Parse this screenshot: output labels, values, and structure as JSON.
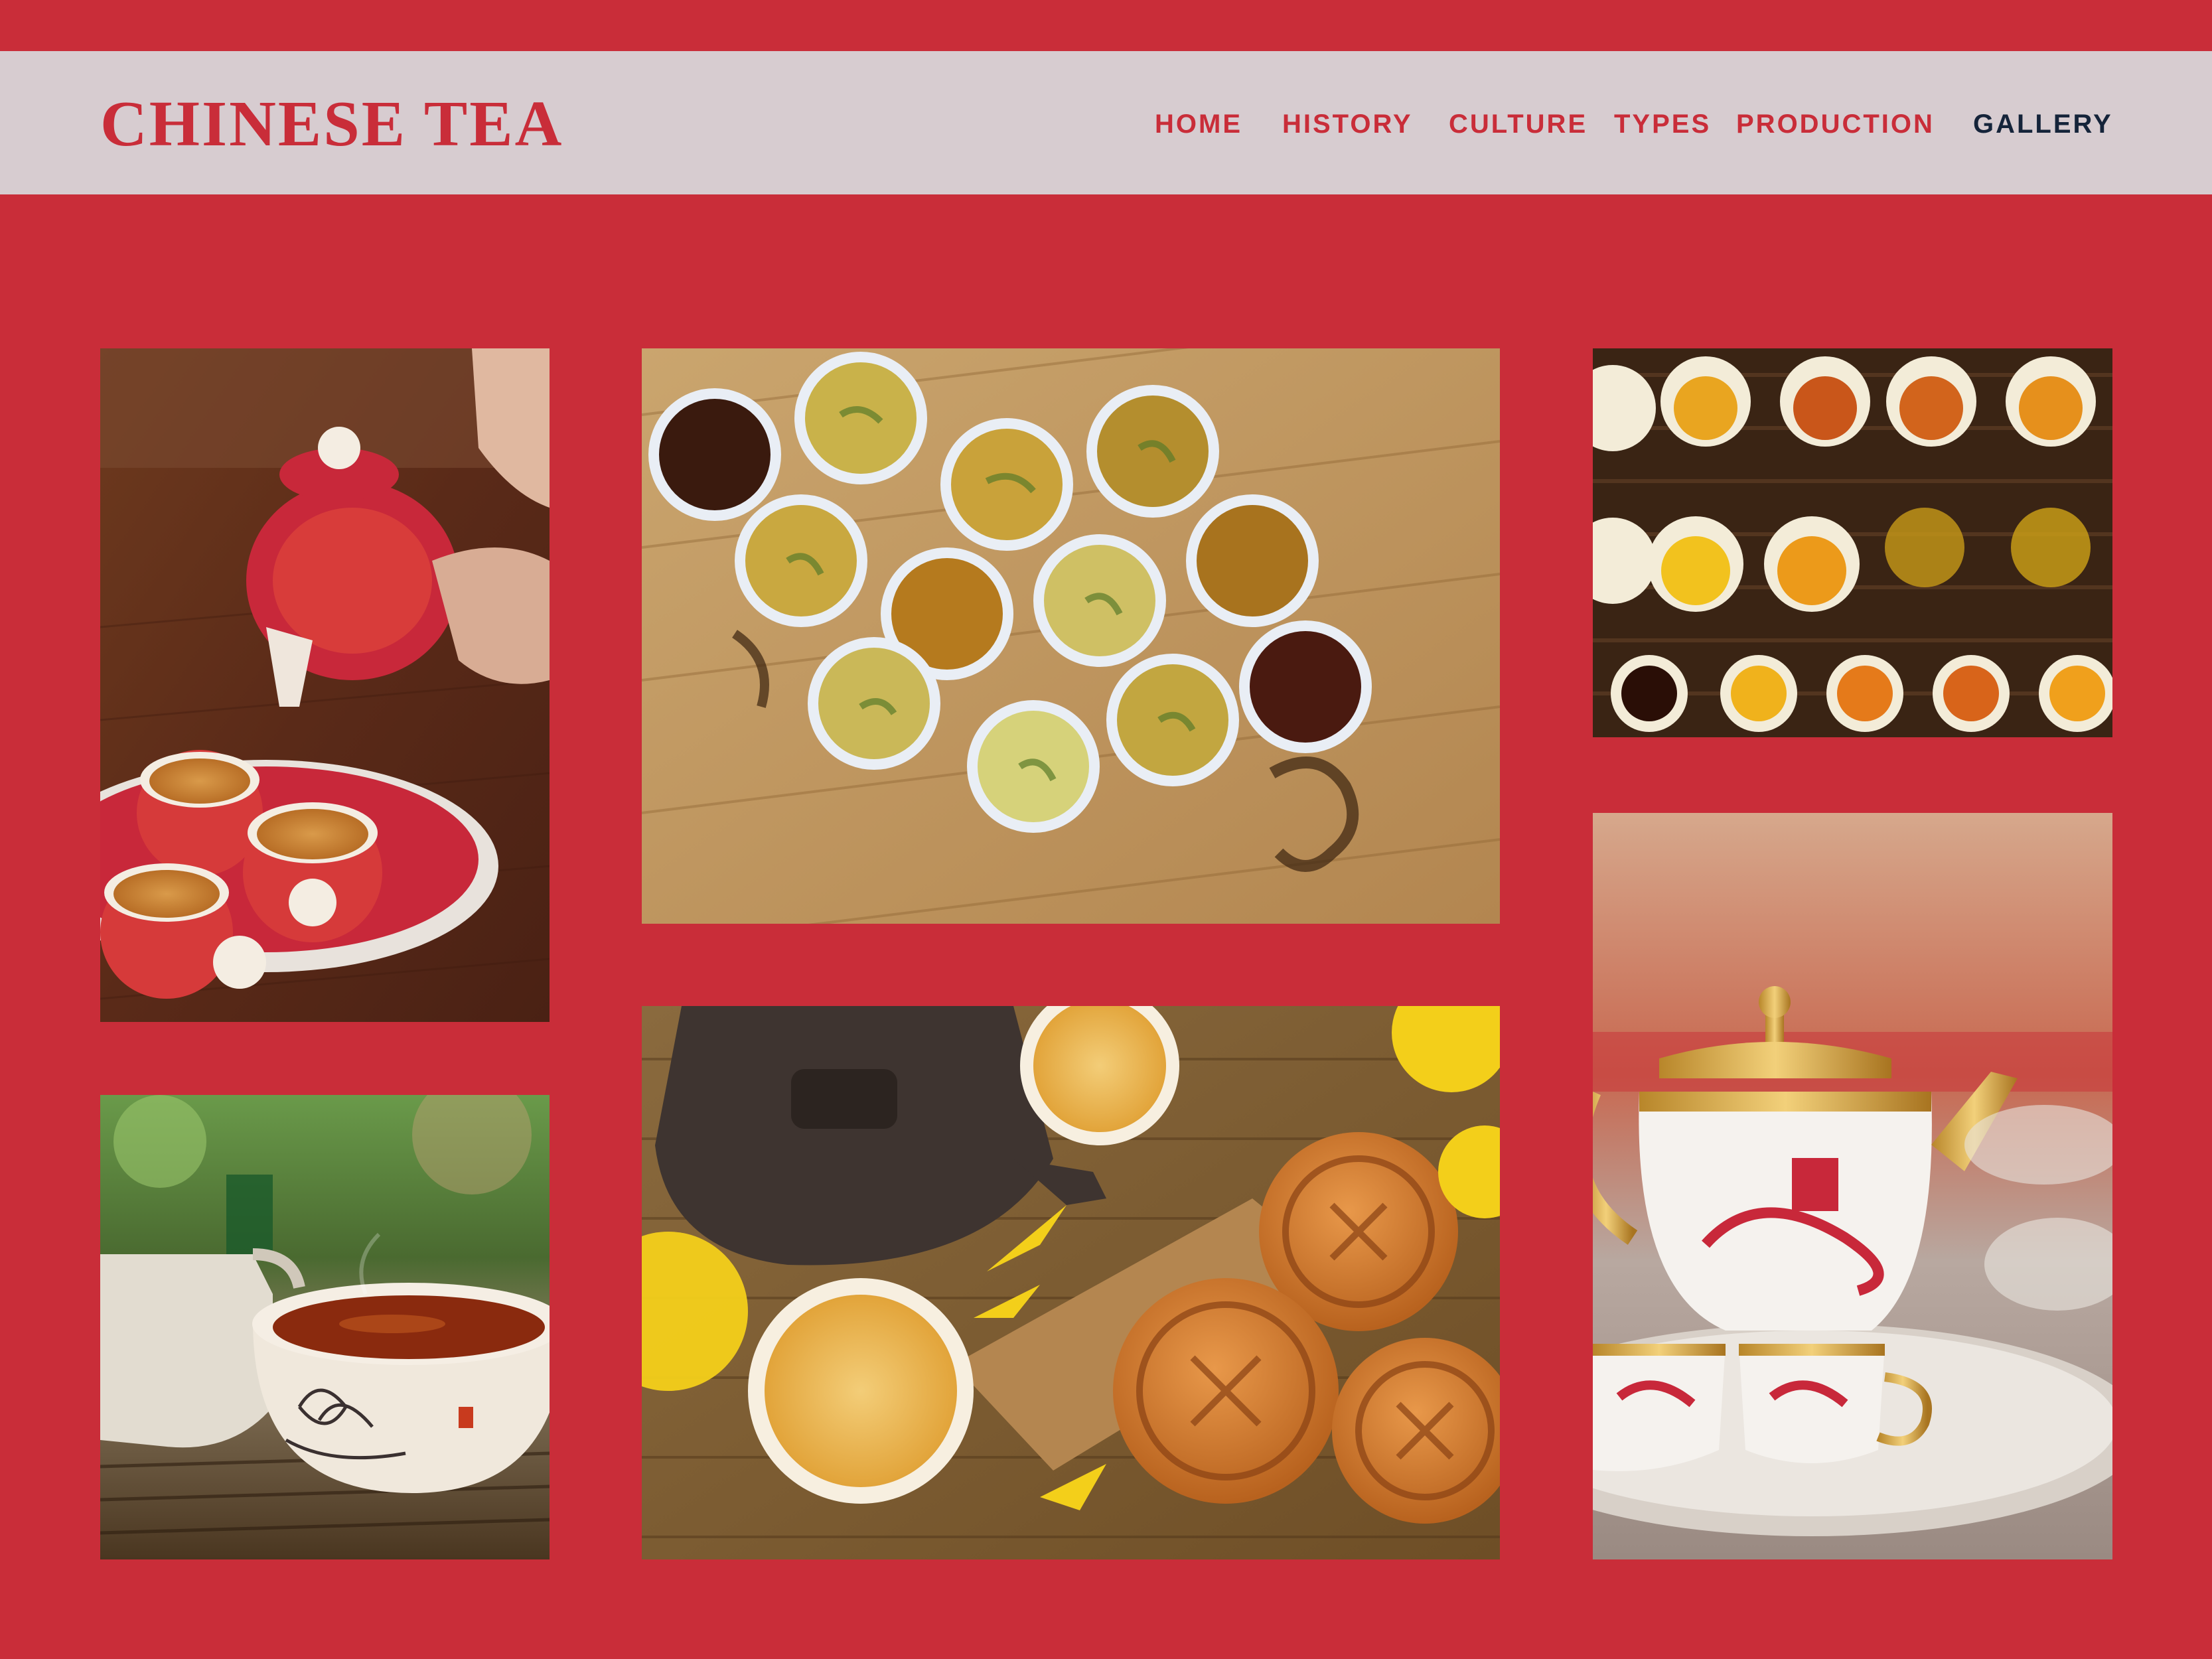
{
  "site": {
    "brand": "CHINESE TEA"
  },
  "nav": {
    "items": [
      {
        "label": "HOME",
        "active": false
      },
      {
        "label": "HISTORY",
        "active": false
      },
      {
        "label": "CULTURE",
        "active": false
      },
      {
        "label": "TYPES",
        "active": false
      },
      {
        "label": "PRODUCTION",
        "active": false
      },
      {
        "label": "GALLERY",
        "active": true
      }
    ]
  },
  "colors": {
    "background": "#c92d39",
    "navbar": "#d7ccd0",
    "nav_text": "#c92d39",
    "nav_active": "#15243a"
  },
  "gallery": {
    "photos": [
      {
        "name": "photo-teapot-pouring"
      },
      {
        "name": "photo-tea-tasting-cups"
      },
      {
        "name": "photo-tea-pitchers"
      },
      {
        "name": "photo-steaming-tea-cup"
      },
      {
        "name": "photo-mooncakes-teapot"
      },
      {
        "name": "photo-gold-tea-set"
      }
    ]
  }
}
